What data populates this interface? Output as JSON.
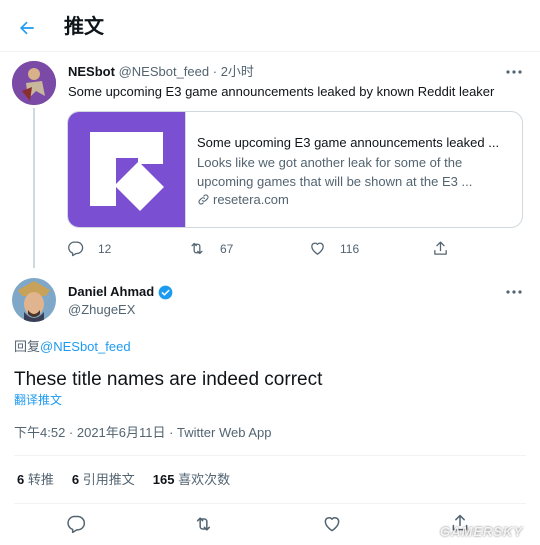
{
  "header": {
    "title": "推文"
  },
  "parent_tweet": {
    "author_name": "NESbot",
    "author_handle": "@NESbot_feed",
    "time_sep": "·",
    "time": "2小时",
    "text": "Some upcoming E3 game announcements leaked by known Reddit leaker",
    "card": {
      "title": "Some upcoming E3 game announcements leaked ...",
      "description": "Looks like we got another leak for some of the upcoming games that will be shown at the E3 ...",
      "domain": "resetera.com",
      "brand_color": "#7b4fd1"
    },
    "actions": {
      "replies": "12",
      "retweets": "67",
      "likes": "116"
    }
  },
  "main_tweet": {
    "author_name": "Daniel Ahmad",
    "author_handle": "@ZhugeEX",
    "reply_prefix": "回复",
    "reply_to": "@NESbot_feed",
    "text": "These title names are indeed correct",
    "translate": "翻译推文",
    "timestamp": "下午4:52 · 2021年6月11日 · Twitter Web App",
    "stats": {
      "retweets_count": "6",
      "retweets_label": "转推",
      "quotes_count": "6",
      "quotes_label": "引用推文",
      "likes_count": "165",
      "likes_label": "喜欢次数"
    }
  },
  "watermark": "GAMERSKY",
  "colors": {
    "accent": "#1d9bf0",
    "verified": "#1d9bf0",
    "text": "#0f1419",
    "muted": "#536471"
  }
}
